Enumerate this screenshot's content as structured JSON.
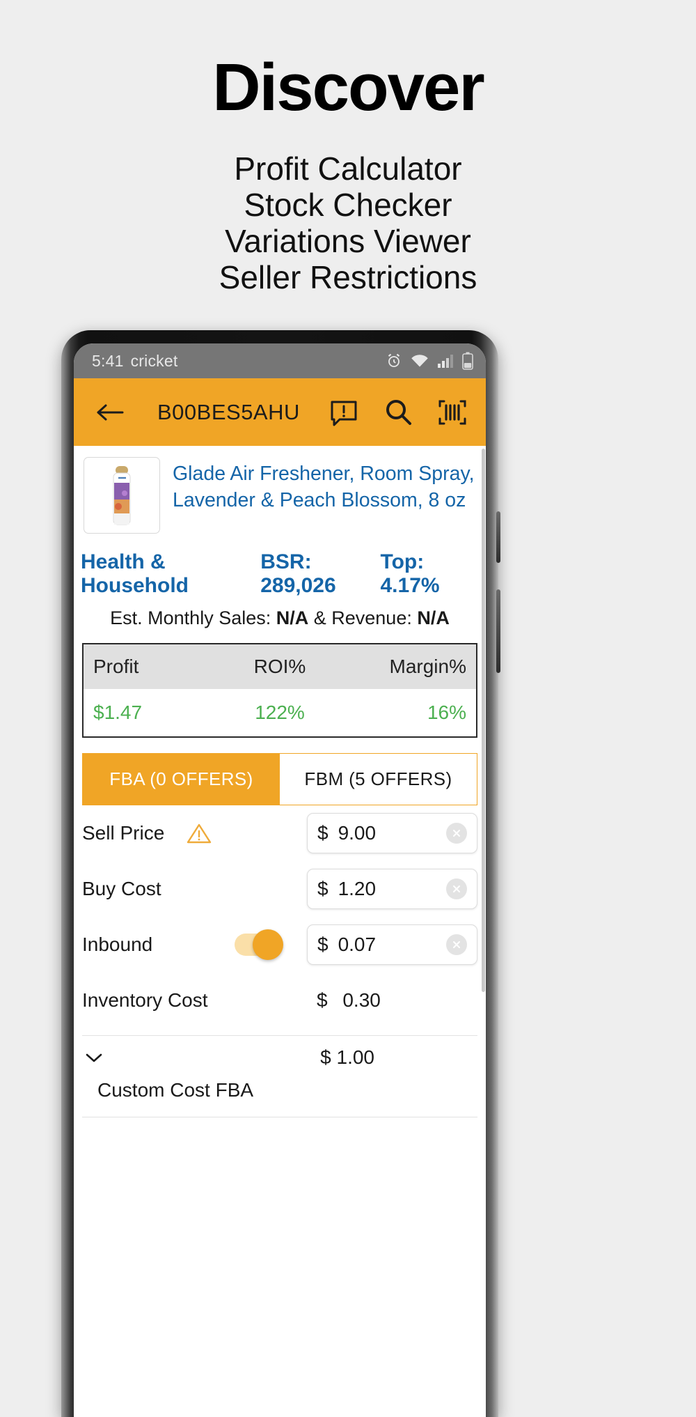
{
  "promo": {
    "title": "Discover",
    "features": [
      "Profit Calculator",
      "Stock Checker",
      "Variations Viewer",
      "Seller Restrictions"
    ]
  },
  "phone": {
    "statusbar": {
      "time": "5:41",
      "carrier": "cricket",
      "icons": [
        "alarm-icon",
        "wifi-icon",
        "signal-icon",
        "battery-icon"
      ]
    },
    "appbar": {
      "back_icon": "back-arrow-icon",
      "asin": "B00BES5AHU",
      "note_icon": "note-alert-icon",
      "search_icon": "search-icon",
      "scan_icon": "barcode-scan-icon",
      "bg": "#f0a526"
    },
    "product": {
      "thumb_alt": "glade-air-freshener-can",
      "title": "Glade Air Freshener, Room Spray, Lavender & Peach Blossom, 8 oz",
      "title_color": "#1565a8"
    },
    "stats": {
      "category": "Health & Household",
      "bsr_label": "BSR:",
      "bsr_value": "289,026",
      "top_label": "Top:",
      "top_value": "4.17%",
      "est_prefix": "Est. Monthly Sales: ",
      "est_sales": "N/A",
      "est_mid": " & Revenue: ",
      "est_revenue": "N/A"
    },
    "profit_table": {
      "headers": [
        "Profit",
        "ROI%",
        "Margin%"
      ],
      "values": [
        "$1.47",
        "122%",
        "16%"
      ],
      "value_color": "#4cb050"
    },
    "tabs": [
      {
        "label": "FBA (0 OFFERS)",
        "active": true
      },
      {
        "label": "FBM (5 OFFERS)",
        "active": false
      }
    ],
    "fields": [
      {
        "label": "Sell Price",
        "currency": "$",
        "value": "9.00",
        "has_warning": true,
        "has_toggle": false,
        "boxed": true,
        "clearable": true
      },
      {
        "label": "Buy Cost",
        "currency": "$",
        "value": "1.20",
        "has_warning": false,
        "has_toggle": false,
        "boxed": true,
        "clearable": true
      },
      {
        "label": "Inbound",
        "currency": "$",
        "value": "0.07",
        "has_warning": false,
        "has_toggle": true,
        "boxed": true,
        "clearable": true
      },
      {
        "label": "Inventory Cost",
        "currency": "$",
        "value": "0.30",
        "has_warning": false,
        "has_toggle": false,
        "boxed": false,
        "clearable": false
      }
    ],
    "custom": {
      "chevron_icon": "chevron-down-icon",
      "currency": "$",
      "amount": "1.00",
      "label": "Custom Cost FBA"
    }
  }
}
